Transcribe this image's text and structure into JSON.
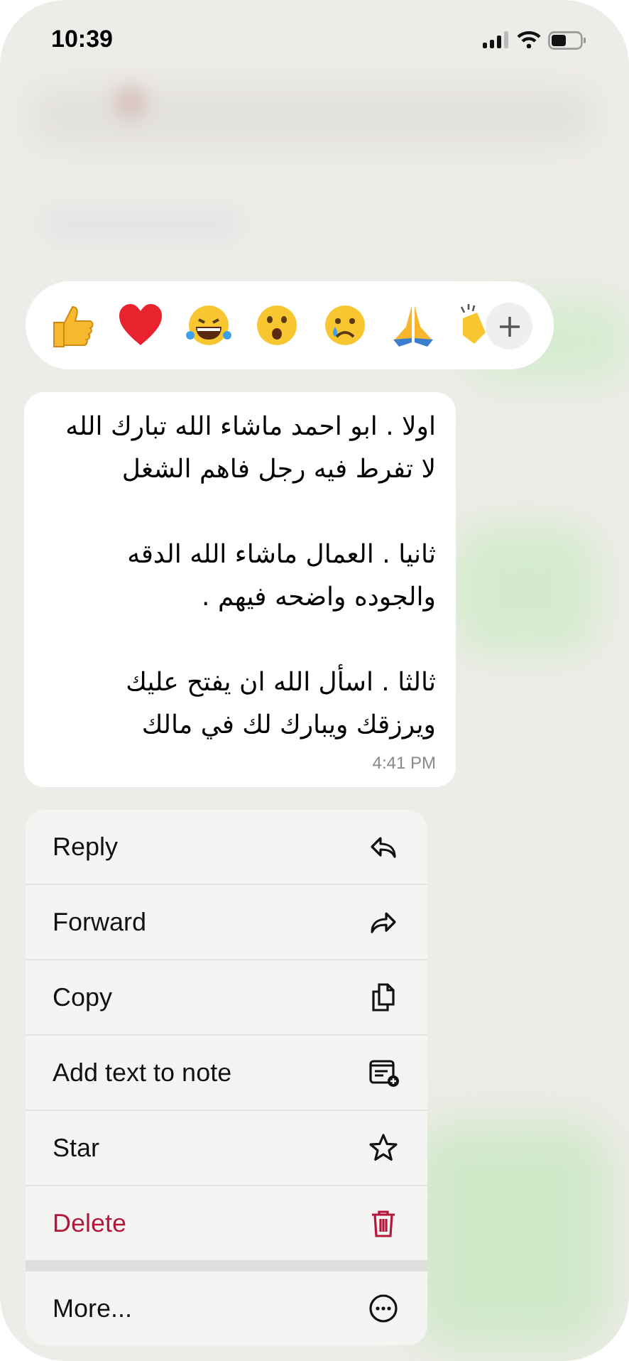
{
  "status_bar": {
    "time": "10:39"
  },
  "message": {
    "text": "اولا . ابو احمد ماشاء الله تبارك الله لا تفرط فيه رجل فاهم الشغل\n\nثانيا . العمال ماشاء الله الدقه والجوده واضحه فيهم .\n\nثالثا . اسأل الله ان يفتح عليك ويرزقك ويبارك لك في مالك",
    "time": "4:41 PM"
  },
  "menu": [
    {
      "label": "Reply",
      "destructive": false,
      "separated_above": false
    },
    {
      "label": "Forward",
      "destructive": false,
      "separated_above": false
    },
    {
      "label": "Copy",
      "destructive": false,
      "separated_above": false
    },
    {
      "label": "Add text to note",
      "destructive": false,
      "separated_above": false
    },
    {
      "label": "Star",
      "destructive": false,
      "separated_above": false
    },
    {
      "label": "Delete",
      "destructive": true,
      "separated_above": false
    },
    {
      "label": "More...",
      "destructive": false,
      "separated_above": true
    }
  ]
}
